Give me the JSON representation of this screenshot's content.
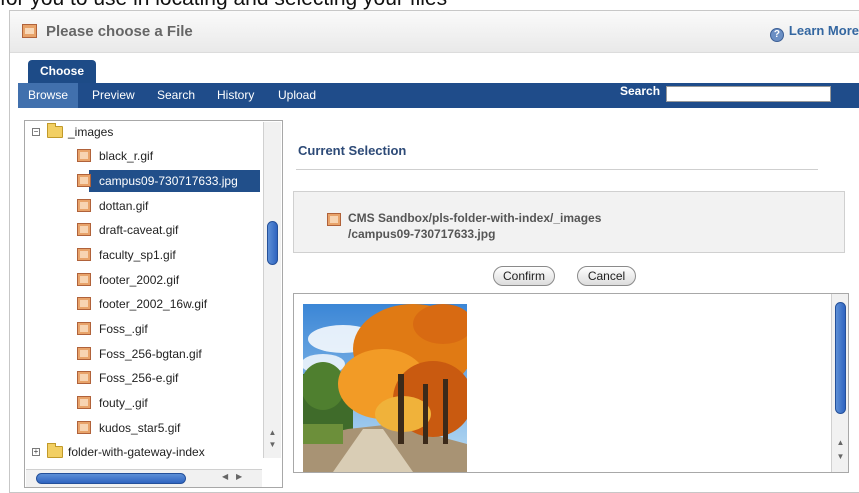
{
  "background_text": "for you to use in locating and selecting your files",
  "dialog": {
    "title": "Please choose a File",
    "learn_more": "Learn More"
  },
  "tabs": [
    {
      "label": "Choose"
    }
  ],
  "nav": {
    "items": [
      "Browse",
      "Preview",
      "Search",
      "History",
      "Upload"
    ],
    "search_label": "Search",
    "search_value": ""
  },
  "tree": {
    "root_folder": "_images",
    "files": [
      "black_r.gif",
      "campus09-730717633.jpg",
      "dottan.gif",
      "draft-caveat.gif",
      "faculty_sp1.gif",
      "footer_2002.gif",
      "footer_2002_16w.gif",
      "Foss_.gif",
      "Foss_256-bgtan.gif",
      "Foss_256-e.gif",
      "fouty_.gif",
      "kudos_star5.gif"
    ],
    "selected_index": 1,
    "next_folder": "folder-with-gateway-index"
  },
  "selection": {
    "heading": "Current Selection",
    "path_line1": "CMS Sandbox/pls-folder-with-index/_images",
    "path_line2": "/campus09-730717633.jpg"
  },
  "buttons": {
    "confirm": "Confirm",
    "cancel": "Cancel"
  },
  "colors": {
    "nav_bar": "#1f4c8a",
    "tab_active": "#1d4b87",
    "selected_row": "#214f8a",
    "heading": "#2d4a77"
  }
}
